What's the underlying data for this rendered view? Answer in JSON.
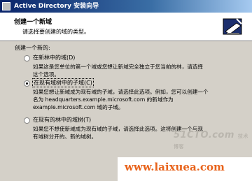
{
  "window": {
    "title": "Active Directory 安装向导"
  },
  "header": {
    "title": "创建一个新域",
    "subtitle": "请选择要创建的域的类型。",
    "icon": "wizard-book-icon"
  },
  "prompt": "创建一个新的:",
  "options": [
    {
      "label": "在新林中的域(D)",
      "checked": false,
      "description": [
        "如果这是您单位的第一个域或您想让新域完全独立于您当前的林，请选择",
        "这个选项。"
      ]
    },
    {
      "label": "在现有域树中的子域(C)",
      "checked": true,
      "description": [
        "如果您想让新域成为现有域的子域，请选择此选项。例如，您可以创建一个",
        "名为 headquarters.example.microsoft.com 的新域作为",
        "example.microsoft.com 域的子域。"
      ]
    },
    {
      "label": "在现有的林中的域树(T)",
      "checked": false,
      "description": [
        "如果您不想使新域成为现有域的子域，请选择此选项。这将创建一个与现",
        "有域树分开的、新的域树。"
      ]
    }
  ],
  "watermarks": {
    "site1": "51CTO.com",
    "site1_sub": "技术博客",
    "site2": "www.laixuea.com"
  }
}
